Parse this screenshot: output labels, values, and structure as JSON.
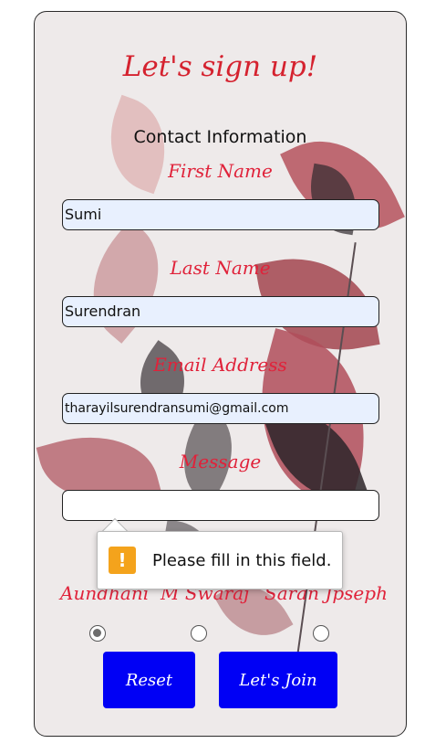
{
  "form": {
    "title": "Let's sign up!",
    "section_title": "Contact Information",
    "first_name_label": "First Name",
    "first_name_value": "Sumi",
    "last_name_label": "Last Name",
    "last_name_value": "Surendran",
    "email_label": "Email Address",
    "email_value": "tharayilsurendransumi@gmail.com",
    "message_label": "Message",
    "message_value": ""
  },
  "radios": [
    {
      "label": "Aundhani",
      "checked": true
    },
    {
      "label": "M Swaraj",
      "checked": false
    },
    {
      "label": "Saran Jpseph",
      "checked": false
    }
  ],
  "buttons": {
    "reset_label": "Reset",
    "join_label": "Let's Join"
  },
  "tooltip": {
    "icon": "warning-icon",
    "text": "Please fill in this field."
  },
  "colors": {
    "accent_red": "#e0223a",
    "button_blue": "#0000f5",
    "warning": "#f4a31c"
  }
}
